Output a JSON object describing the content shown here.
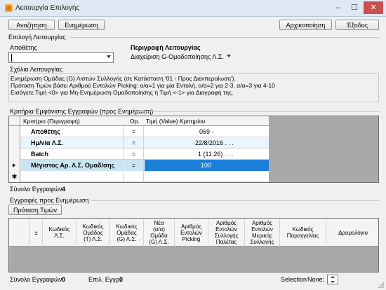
{
  "window": {
    "title": "Λειτουργία Επιλογής",
    "minimize": "–",
    "maximize": "☐",
    "close": "✕"
  },
  "toolbar": {
    "search_label": "Αναζήτηση",
    "update_label": "Ενημέρωση",
    "reset_label": "Αρχικοποίηση",
    "exit_label": "Έξοδος"
  },
  "selection": {
    "group_label": "Επιλογή Λειτουργίας",
    "warehouse_label": "Αποθέτης",
    "warehouse_value": "",
    "description_label": "Περιγραφή Λειτουργίας",
    "description_value": "Διαχείριση G-Ομαδοποίησης Λ.Σ."
  },
  "notes": {
    "label": "Σχόλια Λειτουργίας",
    "lines": [
      "Ενημέρωση Ομάδας (G) Λιστών Συλλογής (σε Κατάσταση '01 - Προς Διεκπεραίωση').",
      "Πρόταση Τιμών βάσει Αριθμού Εντολών Picking: α/α=1 για μία Εντολή, α/α=2 για 2-3, α/α=3 για 4-10",
      "Εισάγετε Τιμή <0> για Μη-Ενημέρωση Ομαδοποίησης ή Τιμή <-1> για Διαγραφή της."
    ]
  },
  "criteria": {
    "label": "Κριτήρια Εμφάνισης Εγγραφών (προς Ενημέρωση)",
    "headers": [
      "Κριτήριο (Περιγραφή)",
      "Op.",
      "Τιμή (Value) Κριτηρίου"
    ],
    "rows": [
      {
        "name": "Αποθέτης",
        "op": "=",
        "value": "069 -"
      },
      {
        "name": "Ημ/νία Λ.Σ.",
        "op": "=",
        "value": "22/8/2016  . . ."
      },
      {
        "name": "Batch",
        "op": "=",
        "value": "1  (11:26)  . . ."
      },
      {
        "name": "Μέγιστος Αρ. Λ.Σ. Ομαδ/σης",
        "op": "=",
        "value": "100"
      }
    ],
    "new_row_marker": "✱",
    "total_label": "Σύνολο Εγγραφών:",
    "total_value": "4"
  },
  "records": {
    "label": "Εγγραφές προς Ενημέρωση",
    "suggest_label": "Πρόταση Τιμών",
    "sort_glyph": "±",
    "columns": [
      "Κωδικός\nΛ.Σ.",
      "Κωδικός\nΟμάδας\n(T) Λ.Σ.",
      "Κωδικός\nΟμάδας\n(G) Λ.Σ.",
      "Νέα\n(α/α)\nΟμάδα\n(G) Λ.Σ.",
      "Αριθμός\nΕντολών\nPicking",
      "Αριθμός\nΕντολών\nΣυλλογής\nΠαλέτας",
      "Αριθμός\nΕντολών\nΜερικής\nΣυλλογής",
      "Κωδικός\nΠαραγγελίας",
      "Δρομολόγιο"
    ]
  },
  "status": {
    "total_label": "Σύνολο Εγγραφών:",
    "total_value": "0",
    "selected_label": "Επιλ. Εγγρ.:",
    "selected_value": "0",
    "selection_label": "Selection",
    "selection_value": "None:"
  }
}
